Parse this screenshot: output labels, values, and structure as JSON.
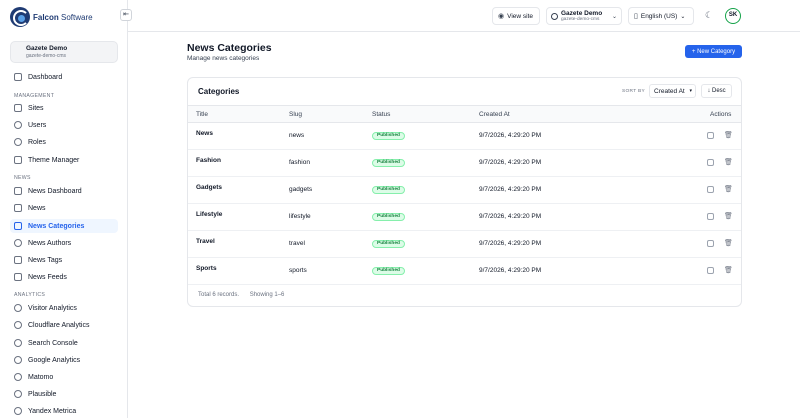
{
  "app": {
    "brand_bold": "Falcon",
    "brand_rest": " Software"
  },
  "workspace": {
    "name": "Gazete Demo",
    "slug": "gazete-demo-cms"
  },
  "sidebar": {
    "dashboard": "Dashboard",
    "management_label": "MANAGEMENT",
    "management": [
      "Sites",
      "Users",
      "Roles",
      "Theme Manager"
    ],
    "news_label": "NEWS",
    "news": [
      "News Dashboard",
      "News",
      "News Categories",
      "News Authors",
      "News Tags",
      "News Feeds"
    ],
    "analytics_label": "ANALYTICS",
    "analytics": [
      "Visitor Analytics",
      "Cloudflare Analytics",
      "Search Console",
      "Google Analytics",
      "Matomo",
      "Plausible",
      "Yandex Metrica"
    ]
  },
  "header": {
    "view_site": "View site",
    "site_name": "Gazete Demo",
    "site_slug": "gazete-demo-cms",
    "language": "English (US)",
    "avatar": "SK"
  },
  "page": {
    "title": "News Categories",
    "subtitle": "Manage news categories",
    "new_button": "+ New Category"
  },
  "table": {
    "card_title": "Categories",
    "sort_label": "SORT BY",
    "sort_value": "Created At",
    "direction": "↓ Desc",
    "columns": [
      "Title",
      "Slug",
      "Status",
      "Created At",
      "Actions"
    ],
    "rows": [
      {
        "title": "News",
        "slug": "news",
        "status": "Published",
        "created": "9/7/2026, 4:29:20 PM"
      },
      {
        "title": "Fashion",
        "slug": "fashion",
        "status": "Published",
        "created": "9/7/2026, 4:29:20 PM"
      },
      {
        "title": "Gadgets",
        "slug": "gadgets",
        "status": "Published",
        "created": "9/7/2026, 4:29:20 PM"
      },
      {
        "title": "Lifestyle",
        "slug": "lifestyle",
        "status": "Published",
        "created": "9/7/2026, 4:29:20 PM"
      },
      {
        "title": "Travel",
        "slug": "travel",
        "status": "Published",
        "created": "9/7/2026, 4:29:20 PM"
      },
      {
        "title": "Sports",
        "slug": "sports",
        "status": "Published",
        "created": "9/7/2026, 4:29:20 PM"
      }
    ],
    "total": "Total 6 records.",
    "showing": "Showing 1–6"
  },
  "colors": {
    "accent": "#2563eb",
    "status_published": "#15803d",
    "brand": "#1f3b73"
  }
}
